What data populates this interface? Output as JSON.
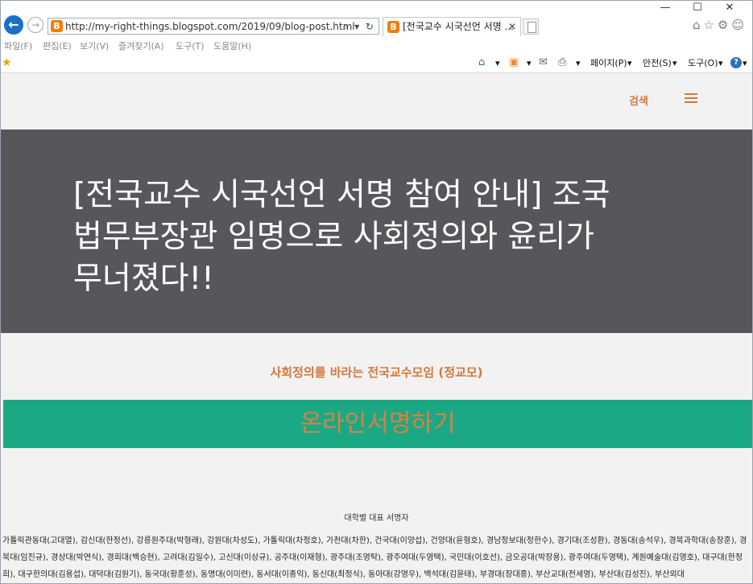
{
  "browser": {
    "url": "http://my-right-things.blogspot.com/2019/09/blog-post.html",
    "tab_title": "[전국교수 시국선언 서명 ...",
    "favicon_letter": "B",
    "nav_back": "←",
    "nav_forward": "→",
    "addr_icons": "⌕ ▾ ↻",
    "tab_close": "✕",
    "window_minimize": "—",
    "window_maximize": "☐",
    "window_close": "✕",
    "right_tools": "⌂☆⚙☺"
  },
  "menu": [
    "파일(F)",
    "편집(E)",
    "보기(V)",
    "즐겨찾기(A)",
    "도구(T)",
    "도움말(H)"
  ],
  "command_bar": {
    "favorites_star": "★",
    "home_icon": "⌂",
    "feed_icon": "▣",
    "mail_icon": "✉",
    "print_icon": "⎙",
    "dropdown": "▾",
    "page": "페이지(P)",
    "safety": "안전(S)",
    "tools": "도구(O)",
    "help": "?"
  },
  "site": {
    "search_label": "검색",
    "hero_title": "[전국교수 시국선언 서명 참여 안내] 조국 법무부장관 임명으로 사회정의와 윤리가 무너졌다!!",
    "org_name": "사회정의를 바라는 전국교수모임 (정교모)",
    "sign_button": "온라인서명하기",
    "list_header": "대학별 대표 서명자",
    "signers": "가톨릭관동대(고대열), 감신대(한정선), 강릉원주대(박형래), 강원대(차성도), 가톨릭대(차정호), 가천대(차한), 건국대(이양섭), 건양대(윤형호), 경남정보대(정한수), 경기대(조성환), 경동대(송석우), 경북과학대(송창훈), 경북대(임진규), 경상대(박연식), 경희대(백승현), 고려대(김일수), 고신대(이상규), 공주대(이재형), 광주대(조영탁), 광주여대(두영택), 국민대(이호선), 금오공대(박장용), 광주여대(두영택), 계원예술대(김영호), 대구대(한정희), 대구한의대(김용섭), 대덕대(김원기), 동국대(황훈성), 동명대(이미련), 동서대(이종익), 동신대(최정식), 동아대(강영우), 백석대(김윤태), 부경대(장대흥), 부산교대(전세영), 부산대(김성진), 부산외대"
  }
}
